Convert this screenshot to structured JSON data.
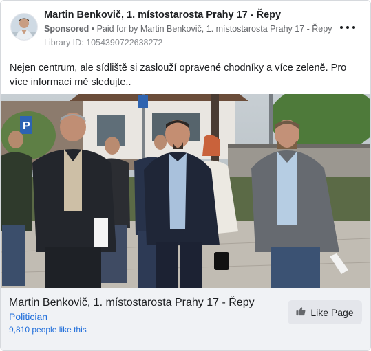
{
  "post": {
    "page_name": "Martin Benkovič, 1. místostarosta Prahy 17 - Řepy",
    "sponsored_label": "Sponsored",
    "paid_prefix": " • Paid for by ",
    "paid_by": "Martin Benkovič, 1. místostarosta Prahy 17 - Řepy",
    "library_id": "Library ID: 1054390722638272",
    "text": "Nejen centrum, ale sídliště si zaslouží opravené chodníky a více zeleně. Pro více informací mě sledujte..",
    "menu_icon": "more-horizontal-icon"
  },
  "footer": {
    "page_title": "Martin Benkovič, 1. místostarosta Prahy 17 - Řepy",
    "category": "Politician",
    "likes": "9,810 people like this",
    "like_button_label": "Like Page",
    "like_icon": "thumbs-up-icon"
  },
  "colors": {
    "link": "#216fdb",
    "footer_bg": "#f0f2f5",
    "button_bg": "#e4e6eb",
    "secondary_text": "#65676b"
  }
}
